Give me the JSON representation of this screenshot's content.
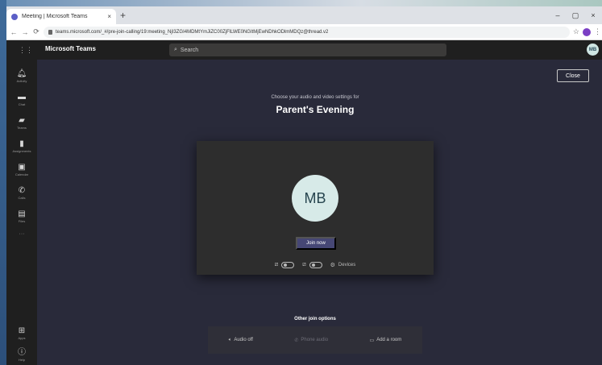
{
  "browser": {
    "tab_title": "Meeting | Microsoft Teams",
    "tab_close": "×",
    "new_tab": "+",
    "url": "teams.microsoft.com/_#/pre-join-calling/19:meeting_NjI3ZGI4MDMtYmJiZC00ZjFlLWE0NGItMjEwNDhkODlmMDQz@thread.v2",
    "win_minimize": "–",
    "win_maximize": "▢",
    "win_close": "×"
  },
  "app": {
    "title": "Microsoft Teams",
    "search_placeholder": "Search",
    "user_initials": "MB"
  },
  "rail": {
    "items": [
      {
        "label": "Activity",
        "icon": "bell-icon"
      },
      {
        "label": "Chat",
        "icon": "chat-icon"
      },
      {
        "label": "Teams",
        "icon": "teams-icon"
      },
      {
        "label": "Assignments",
        "icon": "assignments-icon"
      },
      {
        "label": "Calendar",
        "icon": "calendar-icon"
      },
      {
        "label": "Calls",
        "icon": "phone-icon"
      },
      {
        "label": "Files",
        "icon": "files-icon"
      }
    ],
    "more": "···",
    "bottom": [
      {
        "label": "Apps",
        "icon": "apps-icon"
      },
      {
        "label": "Help",
        "icon": "help-icon"
      }
    ]
  },
  "prejoin": {
    "close_label": "Close",
    "subtitle": "Choose your audio and video settings for",
    "meeting_title": "Parent's Evening",
    "avatar_initials": "MB",
    "join_label": "Join now",
    "devices_label": "Devices",
    "other_title": "Other join options",
    "options": [
      {
        "label": "Audio off",
        "icon": "speaker-off-icon",
        "enabled": true
      },
      {
        "label": "Phone audio",
        "icon": "phone-audio-icon",
        "enabled": false
      },
      {
        "label": "Add a room",
        "icon": "room-icon",
        "enabled": true
      }
    ]
  },
  "colors": {
    "accent": "#464775",
    "stage_bg": "#292a3a",
    "header_bg": "#1f1f1f",
    "avatar_bg": "#d7eae8"
  }
}
